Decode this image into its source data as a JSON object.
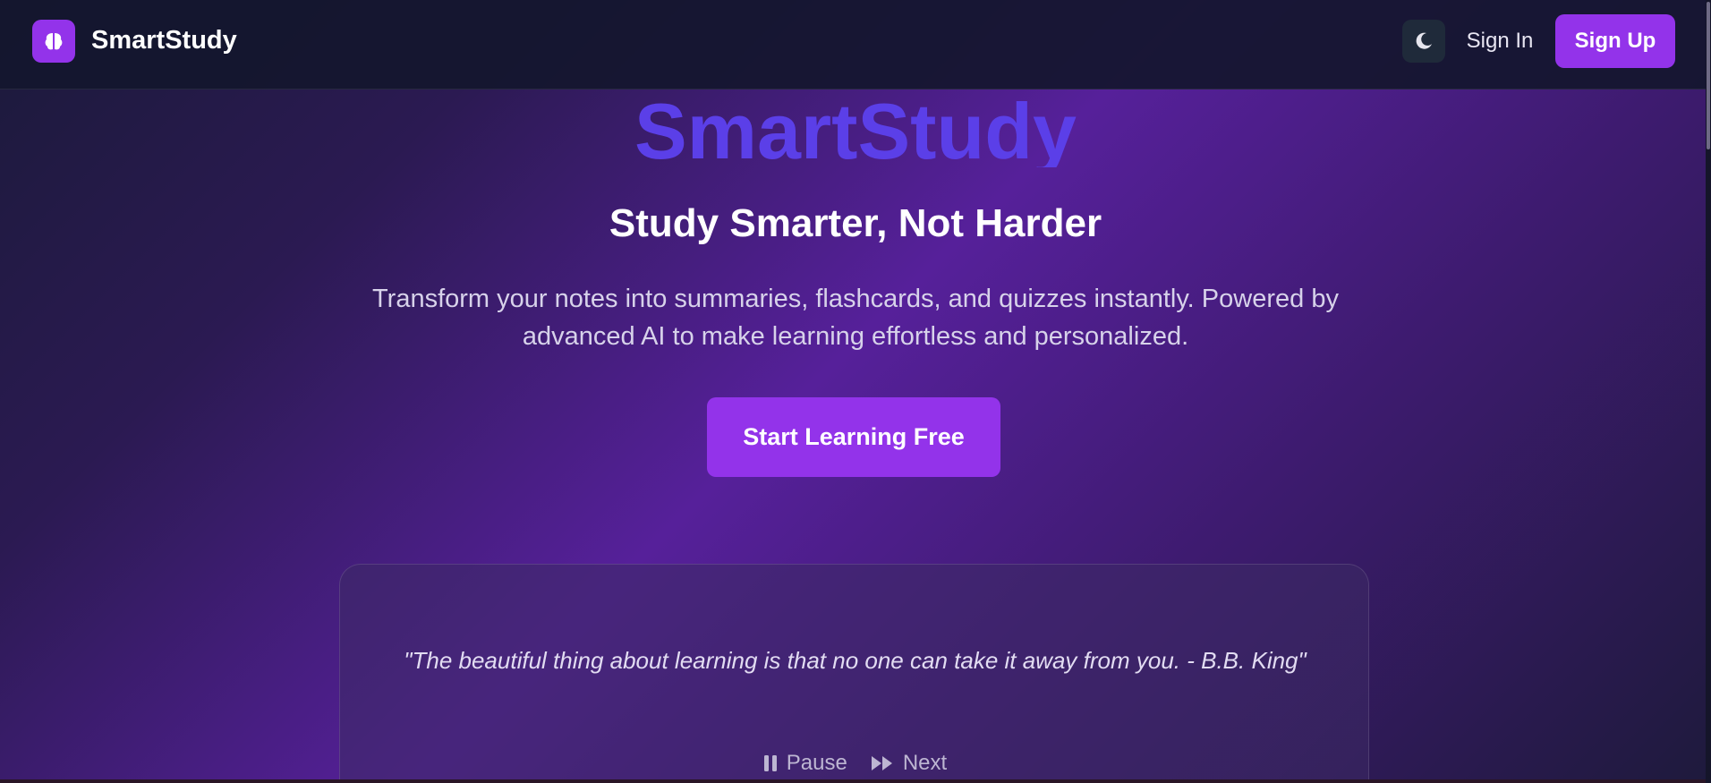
{
  "header": {
    "brand": "SmartStudy",
    "logo_icon": "brain-icon",
    "theme_icon": "moon-icon",
    "signin_label": "Sign In",
    "signup_label": "Sign Up"
  },
  "hero": {
    "title": "SmartStudy",
    "subtitle": "Study Smarter, Not Harder",
    "description": "Transform your notes into summaries, flashcards, and quizzes instantly. Powered by advanced AI to make learning effortless and personalized.",
    "cta_label": "Start Learning Free"
  },
  "quote": {
    "text": "\"The beautiful thing about learning is that no one can take it away from you. - B.B. King\"",
    "pause_label": "Pause",
    "pause_icon": "pause-icon",
    "next_label": "Next",
    "next_icon": "fast-forward-icon"
  },
  "colors": {
    "accent": "#9333ea",
    "title": "#5b3fe8",
    "header_bg": "#14162e"
  }
}
